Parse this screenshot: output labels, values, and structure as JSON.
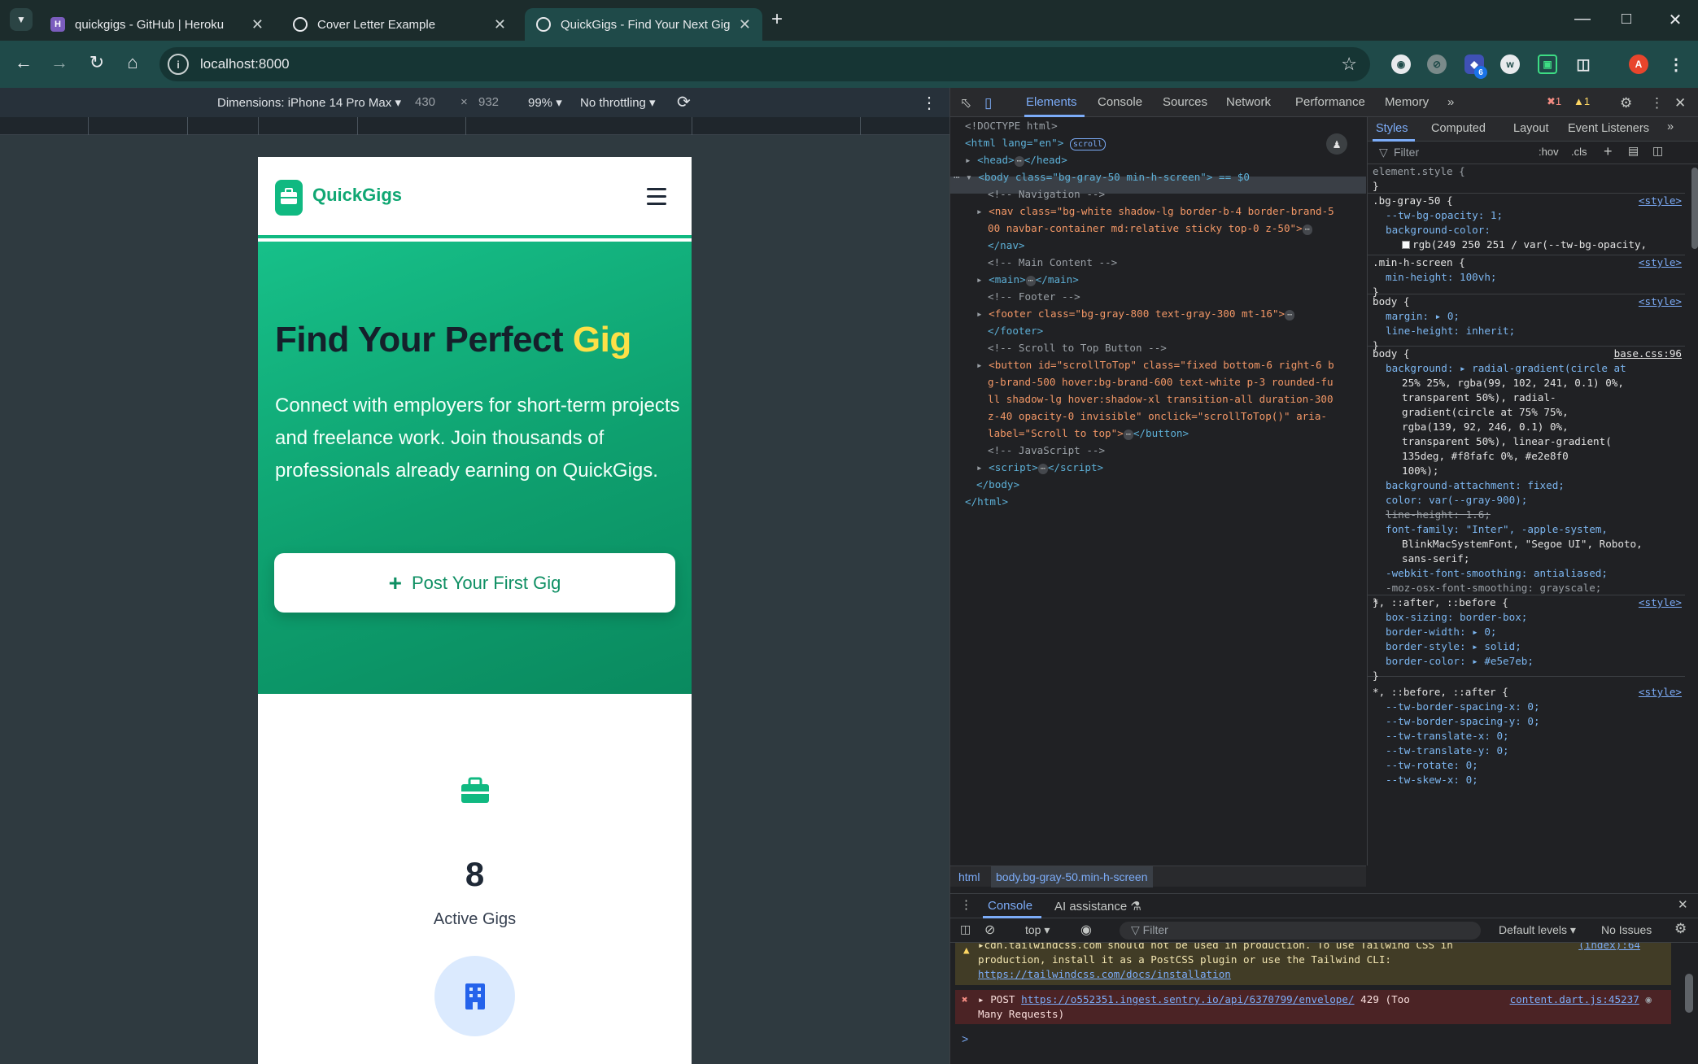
{
  "browser": {
    "tabs": [
      {
        "title": "quickgigs - GitHub | Heroku",
        "active": false,
        "favicon": "heroku-icon"
      },
      {
        "title": "Cover Letter Example",
        "active": false,
        "favicon": "chatgpt-icon"
      },
      {
        "title": "QuickGigs - Find Your Next Gig",
        "active": true,
        "favicon": "globe-icon"
      }
    ],
    "url": "localhost:8000",
    "profile_initial": "A",
    "extension_badge": "6"
  },
  "device_toolbar": {
    "dimensions_label": "Dimensions: iPhone 14 Pro Max",
    "width": "430",
    "height": "932",
    "zoom": "99%",
    "throttling": "No throttling"
  },
  "app": {
    "brand": "QuickGigs",
    "hero": {
      "title_main": "Find Your Perfect ",
      "title_highlight": "Gig",
      "subtitle": "Connect with employers for short-term projects and freelance work. Join thousands of professionals already earning on QuickGigs.",
      "cta": "Post Your First Gig"
    },
    "stat": {
      "value": "8",
      "label": "Active Gigs"
    }
  },
  "devtools": {
    "tabs": [
      "Elements",
      "Console",
      "Sources",
      "Network",
      "Performance",
      "Memory"
    ],
    "error_count": "1",
    "warning_count": "1",
    "styles_tabs": [
      "Styles",
      "Computed",
      "Layout",
      "Event Listeners"
    ],
    "filter_placeholder": "Filter",
    "hov": ":hov",
    "cls": ".cls",
    "breadcrumbs": [
      "html",
      "body.bg-gray-50.min-h-screen"
    ],
    "drawer_tabs": [
      "Console",
      "AI assistance"
    ],
    "console_context": "top",
    "console_filter": "Filter",
    "levels": "Default levels",
    "issues": "No Issues",
    "dom_lines": [
      "<!DOCTYPE html>",
      "<html lang=\"en\">",
      "<head>",
      "<body class=\"bg-gray-50 min-h-screen\"> == $0",
      "<!-- Navigation -->",
      "<nav class=\"bg-white shadow-lg border-b-4 border-brand-5",
      "00 navbar-container md:relative sticky top-0 z-50\">",
      "</nav>",
      "<!-- Main Content -->",
      "<main>",
      "<!-- Footer -->",
      "<footer class=\"bg-gray-800 text-gray-300 mt-16\">",
      "</footer>",
      "<!-- Scroll to Top Button -->",
      "<button id=\"scrollToTop\" class=\"fixed bottom-6 right-6 b",
      "g-brand-500 hover:bg-brand-600 text-white p-3 rounded-fu",
      "ll shadow-lg hover:shadow-xl transition-all duration-300",
      "z-40 opacity-0 invisible\" onclick=\"scrollToTop()\" aria-",
      "label=\"Scroll to top\">",
      "<!-- JavaScript -->",
      "<script>",
      "</body>",
      "</html>"
    ],
    "scroll_badge": "scroll",
    "css_rules": [
      {
        "selector": "element.style {",
        "source": ""
      },
      {
        "selector": ".bg-gray-50 {",
        "source": "<style>",
        "decls": [
          "--tw-bg-opacity: 1;",
          "background-color:",
          "rgb(249 250 251 / var(--tw-bg-opacity,"
        ]
      },
      {
        "selector": ".min-h-screen {",
        "source": "<style>",
        "decls": [
          "min-height: 100vh;"
        ]
      },
      {
        "selector": "body {",
        "source": "<style>",
        "decls": [
          "margin: ▸ 0;",
          "line-height: inherit;"
        ]
      },
      {
        "selector": "body {",
        "source": "base.css:96",
        "decls": [
          "background: ▸ radial-gradient(circle at",
          "25% 25%, rgba(99, 102, 241, 0.1) 0%,",
          "transparent 50%), radial-",
          "gradient(circle at 75% 75%,",
          "rgba(139, 92, 246, 0.1) 0%,",
          "transparent 50%), linear-gradient(",
          "135deg, #f8fafc 0%, #e2e8f0",
          "100%);",
          "background-attachment: fixed;",
          "color: var(--gray-900);",
          "line-height: 1.6;",
          "font-family: \"Inter\", -apple-system,",
          "BlinkMacSystemFont, \"Segoe UI\", Roboto,",
          "sans-serif;",
          "-webkit-font-smoothing: antialiased;",
          "-moz-osx-font-smoothing: grayscale;"
        ]
      },
      {
        "selector": "*, ::after, ::before {",
        "source": "<style>",
        "decls": [
          "box-sizing: border-box;",
          "border-width: ▸ 0;",
          "border-style: ▸ solid;",
          "border-color: ▸ #e5e7eb;"
        ]
      },
      {
        "selector": "*, ::before, ::after {",
        "source": "<style>",
        "decls": [
          "--tw-border-spacing-x: 0;",
          "--tw-border-spacing-y: 0;",
          "--tw-translate-x: 0;",
          "--tw-translate-y: 0;",
          "--tw-rotate: 0;",
          "--tw-skew-x: 0;"
        ]
      }
    ],
    "console": {
      "warning_text_1": "cdn.tailwindcss.com should not be used in production. To use Tailwind CSS in",
      "warning_text_2": "production, install it as a PostCSS plugin or use the Tailwind CLI:",
      "warning_link": "https://tailwindcss.com/docs/installation",
      "warning_source": "(index):64",
      "error_prefix": "POST",
      "error_link": "https://o552351.ingest.sentry.io/api/6370799/envelope/",
      "error_suffix": "429 (Too",
      "error_suffix2": "Many Requests)",
      "error_source": "content.dart.js:45237",
      "prompt": ">"
    }
  },
  "colors": {
    "brand": "#10b981",
    "highlight": "#fde047",
    "devtools_accent": "#7cacf8"
  }
}
